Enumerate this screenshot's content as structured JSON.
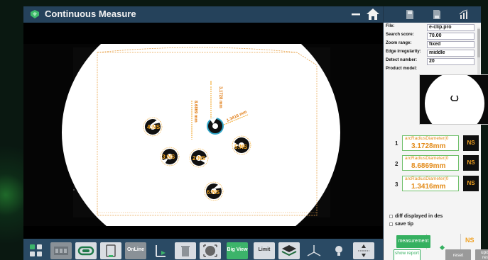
{
  "window": {
    "title": "Continuous Measure"
  },
  "icons": {
    "app": "leaf-shield-icon",
    "minimize": "minimize-icon",
    "home": "home-icon",
    "panel": [
      "save-image-icon",
      "save-data-icon",
      "chart-icon"
    ]
  },
  "properties": [
    {
      "key": "File:",
      "value": "e-clip.pro"
    },
    {
      "key": "Search score:",
      "value": "70.00"
    },
    {
      "key": "Zoom range:",
      "value": "fixed"
    },
    {
      "key": "Edge irregularity:",
      "value": "middle"
    },
    {
      "key": "Detect number:",
      "value": "20"
    },
    {
      "key": "Product model:",
      "value": ""
    }
  ],
  "measurements": [
    {
      "index": "1",
      "label": "arcRadiusDiameter(0",
      "value": "3.1728mm",
      "status": "NS"
    },
    {
      "index": "2",
      "label": "arcRadiusDiameter(0",
      "value": "8.6869mm",
      "status": "NS"
    },
    {
      "index": "3",
      "label": "arcRadiusDiameter(0",
      "value": "1.3416mm",
      "status": "NS"
    }
  ],
  "options": {
    "diff_label": "diff displayed in des",
    "save_tip_label": "save tip"
  },
  "buttons": {
    "measurement": "measurement",
    "show_report": "show report",
    "reset": "reset",
    "update_result": "update result",
    "result_status": "NS"
  },
  "toolbar": {
    "items": [
      {
        "name": "grid-view-icon",
        "label": ""
      },
      {
        "name": "film-strip-icon",
        "label": ""
      },
      {
        "name": "link-icon",
        "label": ""
      },
      {
        "name": "document-icon",
        "label": ""
      },
      {
        "name": "online-button",
        "label": "OnLine"
      },
      {
        "name": "axis-arrow-icon",
        "label": ""
      },
      {
        "name": "trash-icon",
        "label": ""
      },
      {
        "name": "target-frame-icon",
        "label": ""
      },
      {
        "name": "big-view-button",
        "label": "Big View"
      },
      {
        "name": "limit-button",
        "label": "Limit"
      },
      {
        "name": "layers-icon",
        "label": ""
      },
      {
        "name": "axes-3d-icon",
        "label": ""
      },
      {
        "name": "bulb-icon",
        "label": ""
      },
      {
        "name": "split-arrows-icon",
        "label": ""
      }
    ]
  },
  "canvas": {
    "part_labels": [
      "4:NS",
      "3:NS",
      "2:NS",
      "1:NS",
      "5:NS",
      "6:NS"
    ],
    "dimension_labels": [
      "3.1728 mm",
      "8.6869 mm",
      "1.3416 mm"
    ]
  },
  "colors": {
    "accent": "#35b060",
    "warning": "#e38b1a",
    "ns": "#f0a020",
    "dimension": "#f1a21d",
    "titlebar": "#25425b"
  }
}
